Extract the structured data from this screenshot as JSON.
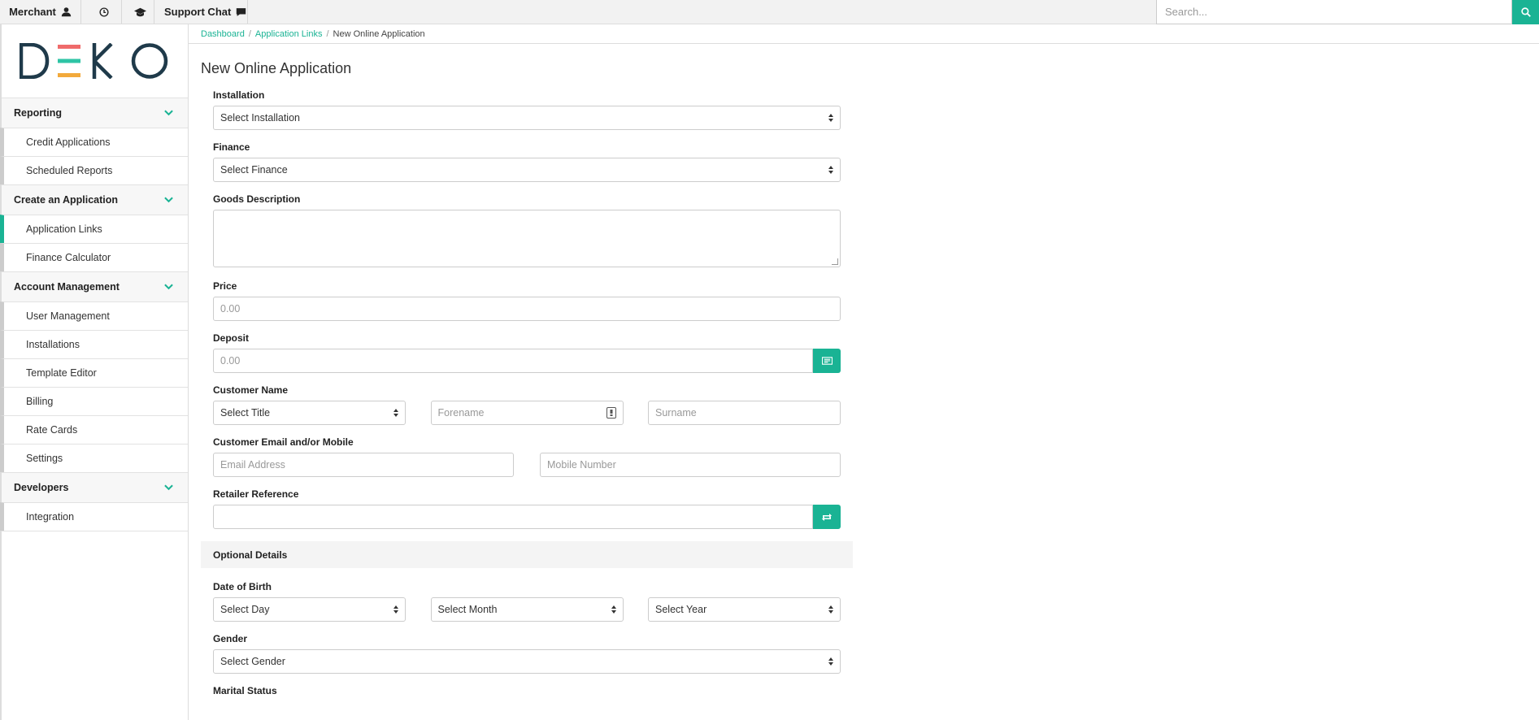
{
  "topbar": {
    "merchant_label": "Merchant",
    "support_label": "Support Chat",
    "search_placeholder": "Search..."
  },
  "brand": {
    "logo_text": "DEKO"
  },
  "sidebar": {
    "sections": [
      {
        "title": "Reporting",
        "items": [
          "Credit Applications",
          "Scheduled Reports"
        ]
      },
      {
        "title": "Create an Application",
        "items": [
          "Application Links",
          "Finance Calculator"
        ]
      },
      {
        "title": "Account Management",
        "items": [
          "User Management",
          "Installations",
          "Template Editor",
          "Billing",
          "Rate Cards",
          "Settings"
        ]
      },
      {
        "title": "Developers",
        "items": [
          "Integration"
        ]
      }
    ],
    "active_item": "Application Links"
  },
  "breadcrumb": {
    "items": [
      "Dashboard",
      "Application Links"
    ],
    "current": "New Online Application"
  },
  "page_title": "New Online Application",
  "form": {
    "installation": {
      "label": "Installation",
      "value": "Select Installation"
    },
    "finance": {
      "label": "Finance",
      "value": "Select Finance"
    },
    "goods_description": {
      "label": "Goods Description",
      "value": ""
    },
    "price": {
      "label": "Price",
      "placeholder": "0.00"
    },
    "deposit": {
      "label": "Deposit",
      "placeholder": "0.00"
    },
    "customer_name": {
      "label": "Customer Name",
      "title_value": "Select Title",
      "forename_placeholder": "Forename",
      "surname_placeholder": "Surname"
    },
    "contact": {
      "label": "Customer Email and/or Mobile",
      "email_placeholder": "Email Address",
      "mobile_placeholder": "Mobile Number"
    },
    "retailer_reference": {
      "label": "Retailer Reference",
      "value": ""
    },
    "optional_details": "Optional Details",
    "dob": {
      "label": "Date of Birth",
      "day": "Select Day",
      "month": "Select Month",
      "year": "Select Year"
    },
    "gender": {
      "label": "Gender",
      "value": "Select Gender"
    },
    "marital_status": {
      "label": "Marital Status"
    }
  },
  "colors": {
    "accent": "#1ab394",
    "logo_red": "#ef6b6b",
    "logo_teal": "#2ec4a5",
    "logo_orange": "#f2a93b",
    "logo_dark": "#1f3a4a"
  },
  "icons": [
    "user-icon",
    "history-icon",
    "graduation-cap-icon",
    "chat-icon",
    "search-icon",
    "chevron-down-icon",
    "calculator-icon",
    "contact-card-icon",
    "refresh-icon"
  ]
}
